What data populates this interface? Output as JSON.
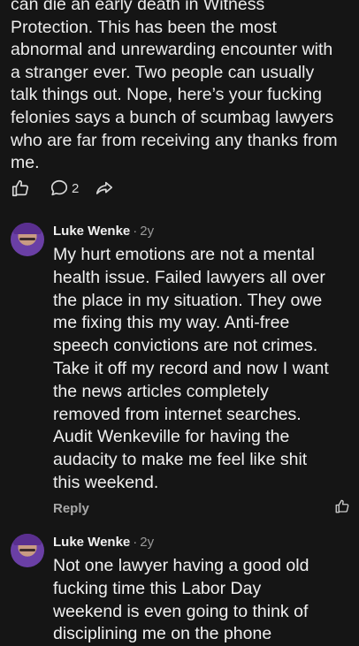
{
  "top_comment": {
    "text": "can die an early death in Witness\nProtection.  This has been the most\nabnormal and unrewarding encounter with\na stranger ever.  Two people can usually\ntalk things out.  Nope, here’s your fucking\nfelonies says a bunch of scumbag lawyers\nwho are far from receiving any thanks from\nme.",
    "actions": {
      "like_icon": "thumbs-up-icon",
      "comment_icon": "comment-bubble-icon",
      "comment_count": "2",
      "share_icon": "share-icon"
    }
  },
  "comments": [
    {
      "author": "Luke Wenke",
      "separator": "·",
      "age": "2y",
      "text": "My hurt emotions are not a mental\nhealth issue.  Failed lawyers all over\nthe place in my situation.  They owe\nme fixing this my way.  Anti-free\nspeech convictions are not crimes.\nTake it off my record and now I want\nthe news articles completely\nremoved from internet searches.\nAudit Wenkeville for having the\naudacity to make me feel like shit\nthis weekend.",
      "reply_label": "Reply"
    },
    {
      "author": "Luke Wenke",
      "separator": "·",
      "age": "2y",
      "text": "Not one lawyer having a good old\nfucking time this Labor Day\nweekend is even going to think of\ndisciplining me on the phone"
    }
  ],
  "colors": {
    "background": "#151515",
    "text": "#f0f0f0",
    "muted": "#9a9a9a"
  }
}
